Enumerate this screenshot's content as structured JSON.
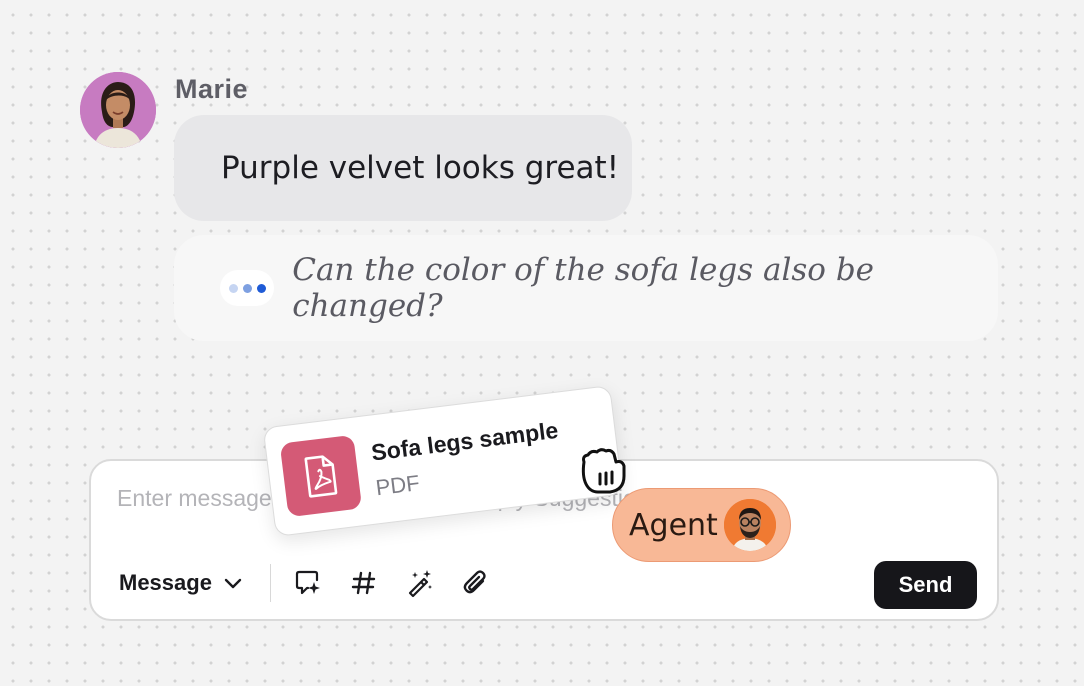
{
  "conversation": {
    "sender_name": "Marie",
    "message_text": "Purple velvet looks great!",
    "typing_text": "Can the color of the sofa legs also be changed?"
  },
  "composer": {
    "placeholder": "Enter message, press \"Space\" for Reply Suggestions",
    "mode_label": "Message",
    "send_label": "Send"
  },
  "attachment": {
    "name": "Sofa legs sample",
    "type": "PDF"
  },
  "agent_tag": {
    "label": "Agent"
  },
  "icons": {
    "mode_toggle": "chevron-down-icon",
    "toolbar": [
      "ai-chat-sparkle-icon",
      "hashtag-icon",
      "magic-wand-icon",
      "paperclip-icon"
    ],
    "attachment": "pdf-file-icon",
    "cursor": "grab-hand-cursor-icon"
  },
  "colors": {
    "page_background": "#f3f3f3",
    "message_bubble": "#e7e7e9",
    "typing_bubble": "#f7f7f7",
    "typing_dot_accent": "#1f5bd6",
    "send_button": "#16161a",
    "pdf_icon_bg": "#d45a76",
    "agent_pill": "#f8b896",
    "avatar_bg": "#c77bc1"
  }
}
